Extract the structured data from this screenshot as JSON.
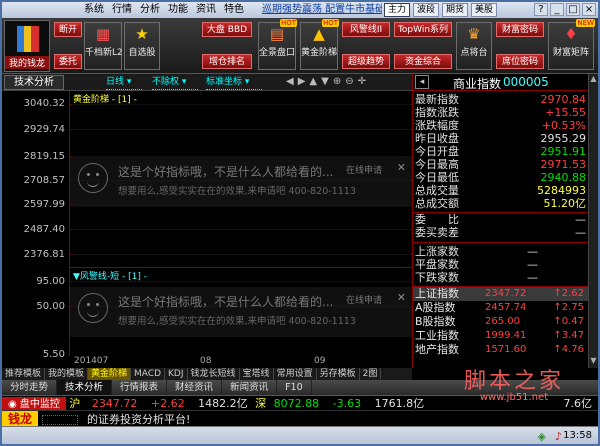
{
  "menu": {
    "items": [
      "系统",
      "行情",
      "分析",
      "功能",
      "资讯",
      "特色"
    ],
    "news": "巡期强势震荡 配置牛市基础",
    "modes": [
      "主力",
      "波段",
      "期货",
      "美股"
    ],
    "active_mode": "主力",
    "win_controls": [
      "?",
      "_",
      "□",
      "×"
    ]
  },
  "toolbar": {
    "logo_label": "我的钱龙",
    "small_buttons": [
      "断开",
      "委托"
    ],
    "buttons": [
      {
        "label": "千档新L2",
        "icon": "chart-icon"
      },
      {
        "label": "自选股",
        "icon": "star-icon"
      },
      {
        "label": "大盘 BBD",
        "sub": "增仓排名"
      },
      {
        "label": "全景盘口",
        "icon": "panorama-icon",
        "hot": "HOT"
      },
      {
        "label": "黄金阶梯",
        "icon": "gold-icon",
        "hot": "HOT"
      },
      {
        "label": "风警线II",
        "sub": "超级趋势"
      },
      {
        "label": "TopWin系列",
        "sub": "资金综合"
      },
      {
        "label": "点将台",
        "icon": "general-icon"
      },
      {
        "label": "财富密码",
        "sub": "席位密码"
      },
      {
        "label": "财富矩阵",
        "icon": "matrix-icon",
        "hot": "NEW"
      }
    ]
  },
  "tabrow": {
    "left_tab": "技术分析",
    "period": "日线",
    "rights": "不除权",
    "coord": "标准坐标",
    "nav_icons": [
      "left-arrow-icon",
      "right-arrow-icon",
      "up-arrow-icon",
      "down-arrow-icon",
      "zoom-in-icon",
      "zoom-out-icon",
      "crosshair-icon"
    ]
  },
  "chart": {
    "y_labels": [
      "3040.32",
      "2929.74",
      "2819.15",
      "2708.57",
      "2597.99",
      "2487.40",
      "2376.81"
    ],
    "y2_labels": [
      "95.00",
      "50.00",
      "5.50"
    ],
    "panel1_title": "黄金阶梯 - [1] -",
    "panel2_title": "▼风警线-短 - [1] -",
    "prompt_line1": "这是个好指标哦，不是什么人都给看的...",
    "prompt_line2": "想要用么,感受实实在在的效果,来申请吧  400-820-1113",
    "prompt_hint": "在线申请",
    "prompt2_line1": "这是个好指标哦，不是什么人都给看的...",
    "prompt2_line2": "想要用么,感受实实在在的效果,来申请吧  400-820-1113",
    "x_labels": [
      "201407",
      "08",
      "09"
    ]
  },
  "quote": {
    "title": "商业指数",
    "code": "000005",
    "rows": [
      {
        "label": "最新指数",
        "value": "2970.84",
        "color": "#ff4040"
      },
      {
        "label": "指数涨跌",
        "value": "+15.55",
        "color": "#ff4040"
      },
      {
        "label": "涨跌幅度",
        "value": "+0.53%",
        "color": "#ff4040"
      },
      {
        "label": "昨日收盘",
        "value": "2955.29",
        "color": "#e0e0e0"
      },
      {
        "label": "今日开盘",
        "value": "2951.91",
        "color": "#00e000"
      },
      {
        "label": "今日最高",
        "value": "2971.53",
        "color": "#ff4040"
      },
      {
        "label": "今日最低",
        "value": "2940.88",
        "color": "#00e000"
      },
      {
        "label": "总成交量",
        "value": "5284993",
        "color": "#ffff40"
      },
      {
        "label": "总成交额",
        "value": "51.20亿",
        "color": "#ffff40"
      }
    ],
    "ratio_label": "委　　比",
    "ratio_value": "—",
    "diff_label": "委买卖差",
    "diff_value": "—",
    "counts": [
      {
        "label": "上涨家数",
        "value": "—"
      },
      {
        "label": "平盘家数",
        "value": "—"
      },
      {
        "label": "下跌家数",
        "value": "—"
      }
    ],
    "indices": [
      {
        "name": "上证指数",
        "price": "2347.72",
        "change": "↑2.62"
      },
      {
        "name": "A股指数",
        "price": "2457.74",
        "change": "↑2.75"
      },
      {
        "name": "B股指数",
        "price": "265.00",
        "change": "↑0.47"
      },
      {
        "name": "工业指数",
        "price": "1999.41",
        "change": "↑3.47"
      },
      {
        "name": "地产指数",
        "price": "1571.60",
        "change": "↑4.76"
      }
    ]
  },
  "bottom_tabs1": [
    "推荐模板",
    "我的模板",
    "黄金阶梯",
    "MACD",
    "KDJ",
    "钱龙长短线",
    "宝塔线",
    "常用设置",
    "另存模板",
    "2图"
  ],
  "bottom_tabs1_active": "黄金阶梯",
  "bottom_tabs2": [
    "分时走势",
    "技术分析",
    "行情报表",
    "财经资讯",
    "新闻资讯",
    "F10"
  ],
  "bottom_tabs2_active": "技术分析",
  "status": {
    "monitor_label": "盘中监控",
    "sh_label": "沪",
    "sh_price": "2347.72",
    "sh_change": "+2.62",
    "sh_amount": "1482.2亿",
    "sz_label": "深",
    "sz_price": "8072.88",
    "sz_change": "-3.63",
    "sz_amount": "1761.8亿",
    "tail_amount": "7.6亿",
    "brand": "钱龙",
    "marquee": "的证券投资分析平台!",
    "time": "13:58"
  },
  "watermark": {
    "text": "脚本之家",
    "url": "www.jb51.net"
  }
}
